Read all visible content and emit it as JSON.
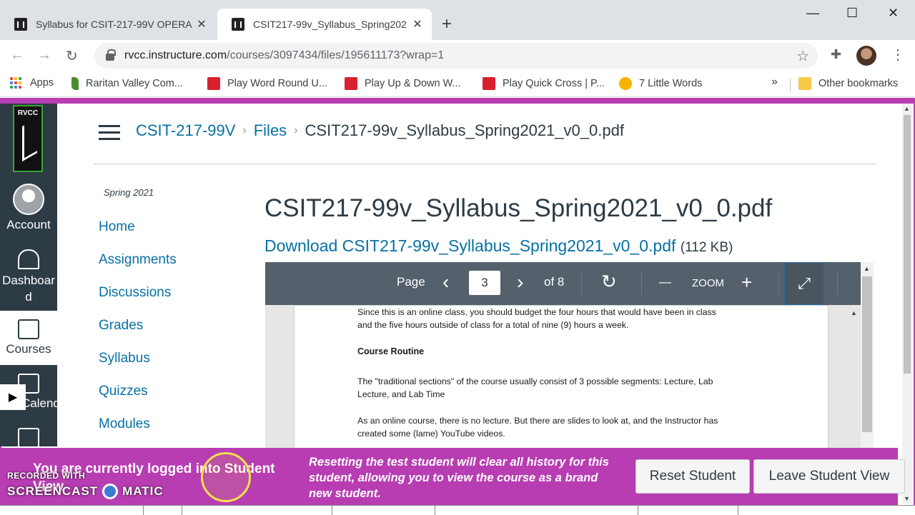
{
  "browser": {
    "tabs": [
      {
        "title": "Syllabus for CSIT-217-99V OPERA",
        "close": "✕"
      },
      {
        "title": "CSIT217-99v_Syllabus_Spring202",
        "close": "✕"
      }
    ],
    "new_tab": "+",
    "window_controls": {
      "minimize": "—",
      "maximize": "☐",
      "close": "✕"
    },
    "url_host": "rvcc.instructure.com",
    "url_path": "/courses/3097434/files/195611173?wrap=1",
    "bookmarks": [
      "Apps",
      "Raritan Valley Com...",
      "Play Word Round U...",
      "Play Up & Down W...",
      "Play Quick Cross | P...",
      "7 Little Words"
    ],
    "bookmarks_overflow": "»",
    "other_bookmarks": "Other bookmarks"
  },
  "global_nav": {
    "logo_text": "RVCC",
    "items": [
      {
        "label": "Account",
        "icon": "account-avatar-icon"
      },
      {
        "label": "Dashboard",
        "icon": "dashboard-icon"
      },
      {
        "label": "Courses",
        "icon": "courses-icon"
      },
      {
        "label": "Calendar",
        "icon": "calendar-icon"
      },
      {
        "label": "Inbox",
        "icon": "inbox-icon"
      }
    ]
  },
  "breadcrumb": {
    "course": "CSIT-217-99V",
    "files": "Files",
    "current": "CSIT217-99v_Syllabus_Spring2021_v0_0.pdf",
    "separator": "›"
  },
  "course_nav": {
    "term": "Spring 2021",
    "items": [
      "Home",
      "Assignments",
      "Discussions",
      "Grades",
      "Syllabus",
      "Quizzes",
      "Modules"
    ]
  },
  "file": {
    "title": "CSIT217-99v_Syllabus_Spring2021_v0_0.pdf",
    "download_label": "Download CSIT217-99v_Syllabus_Spring2021_v0_0.pdf",
    "size": "(112 KB)"
  },
  "viewer": {
    "page_label": "Page",
    "current_page": "3",
    "of_pages": "of 8",
    "zoom_label": "ZOOM",
    "prev": "‹",
    "next": "›",
    "rotate": "↻",
    "zoom_out": "—",
    "zoom_in": "+",
    "expand": "⤢"
  },
  "pdf_text": {
    "p1_line1": "Since this is an online class, you should budget the four hours that would have been in class",
    "p1_line2": "and the five hours outside of class for a total of nine (9) hours a week.",
    "heading": "Course Routine",
    "p2_line1": "The \"traditional sections\" of the course usually consist of 3 possible segments: Lecture, Lab",
    "p2_line2": "Lecture, and Lab Time",
    "p3_line1": "As an online course, there is no lecture.  But there are slides to look at, and the Instructor has",
    "p3_line2": "created some (lame) YouTube videos."
  },
  "student_view": {
    "title_line1": "You are currently logged into Student",
    "title_line2": "View",
    "description": "Resetting the test student will clear all history for this student, allowing you to view the course as a brand new student.",
    "reset_button": "Reset Student",
    "leave_button": "Leave Student View"
  },
  "screencast": {
    "recorded_with": "RECORDED WITH",
    "brand_left": "SCREENCAST",
    "brand_right": "MATIC"
  },
  "colors": {
    "student_banner": "#b83db2",
    "canvas_nav": "#2d3b45",
    "link": "#0770a3"
  }
}
